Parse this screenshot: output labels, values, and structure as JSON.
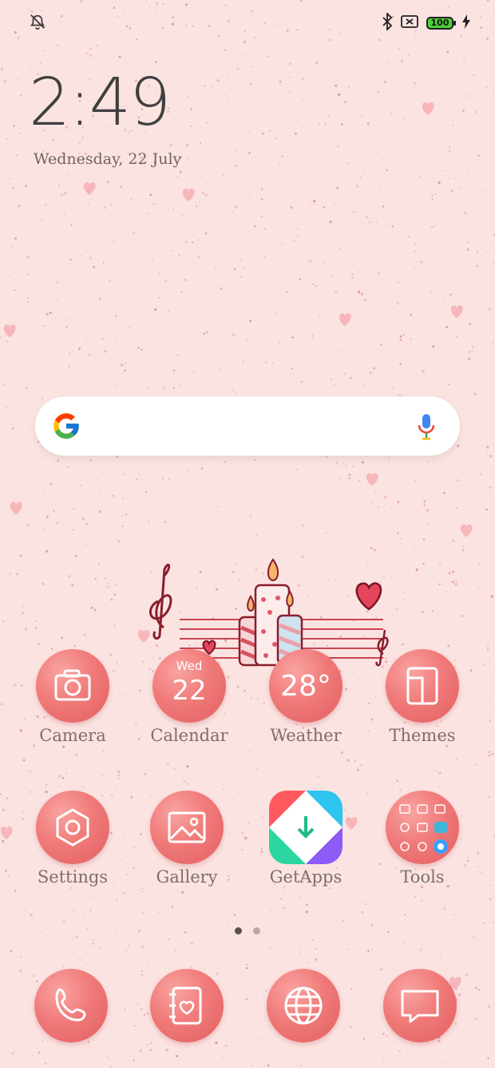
{
  "status_bar": {
    "left_icon": "alarm-off-icon",
    "right_icons": [
      "bluetooth-icon",
      "no-sim-icon",
      "battery-icon",
      "charging-icon"
    ],
    "battery_level": "100"
  },
  "lock_widget": {
    "time": "2:49",
    "date": "Wednesday, 22 July"
  },
  "search_bar": {
    "logo": "google-g-icon",
    "mic": "microphone-icon"
  },
  "widget": {
    "icon": "candles-music-decoration"
  },
  "apps_row1": [
    {
      "label": "Camera",
      "icon": "camera-icon"
    },
    {
      "label": "Calendar",
      "icon": "calendar-icon",
      "day": "Wed",
      "date": "22"
    },
    {
      "label": "Weather",
      "icon": "weather-icon",
      "temp": "28°"
    },
    {
      "label": "Themes",
      "icon": "themes-icon"
    }
  ],
  "apps_row2": [
    {
      "label": "Settings",
      "icon": "settings-icon"
    },
    {
      "label": "Gallery",
      "icon": "gallery-icon"
    },
    {
      "label": "GetApps",
      "icon": "getapps-icon"
    },
    {
      "label": "Tools",
      "icon": "tools-folder-icon"
    }
  ],
  "page_indicator": {
    "pages": 2,
    "current": 1
  },
  "dock": [
    {
      "icon": "phone-icon"
    },
    {
      "icon": "contacts-icon"
    },
    {
      "icon": "browser-icon"
    },
    {
      "icon": "messages-icon"
    }
  ],
  "colors": {
    "background": "#fbe3e1",
    "icon": "#ef7677",
    "accent": "#e35f62"
  }
}
